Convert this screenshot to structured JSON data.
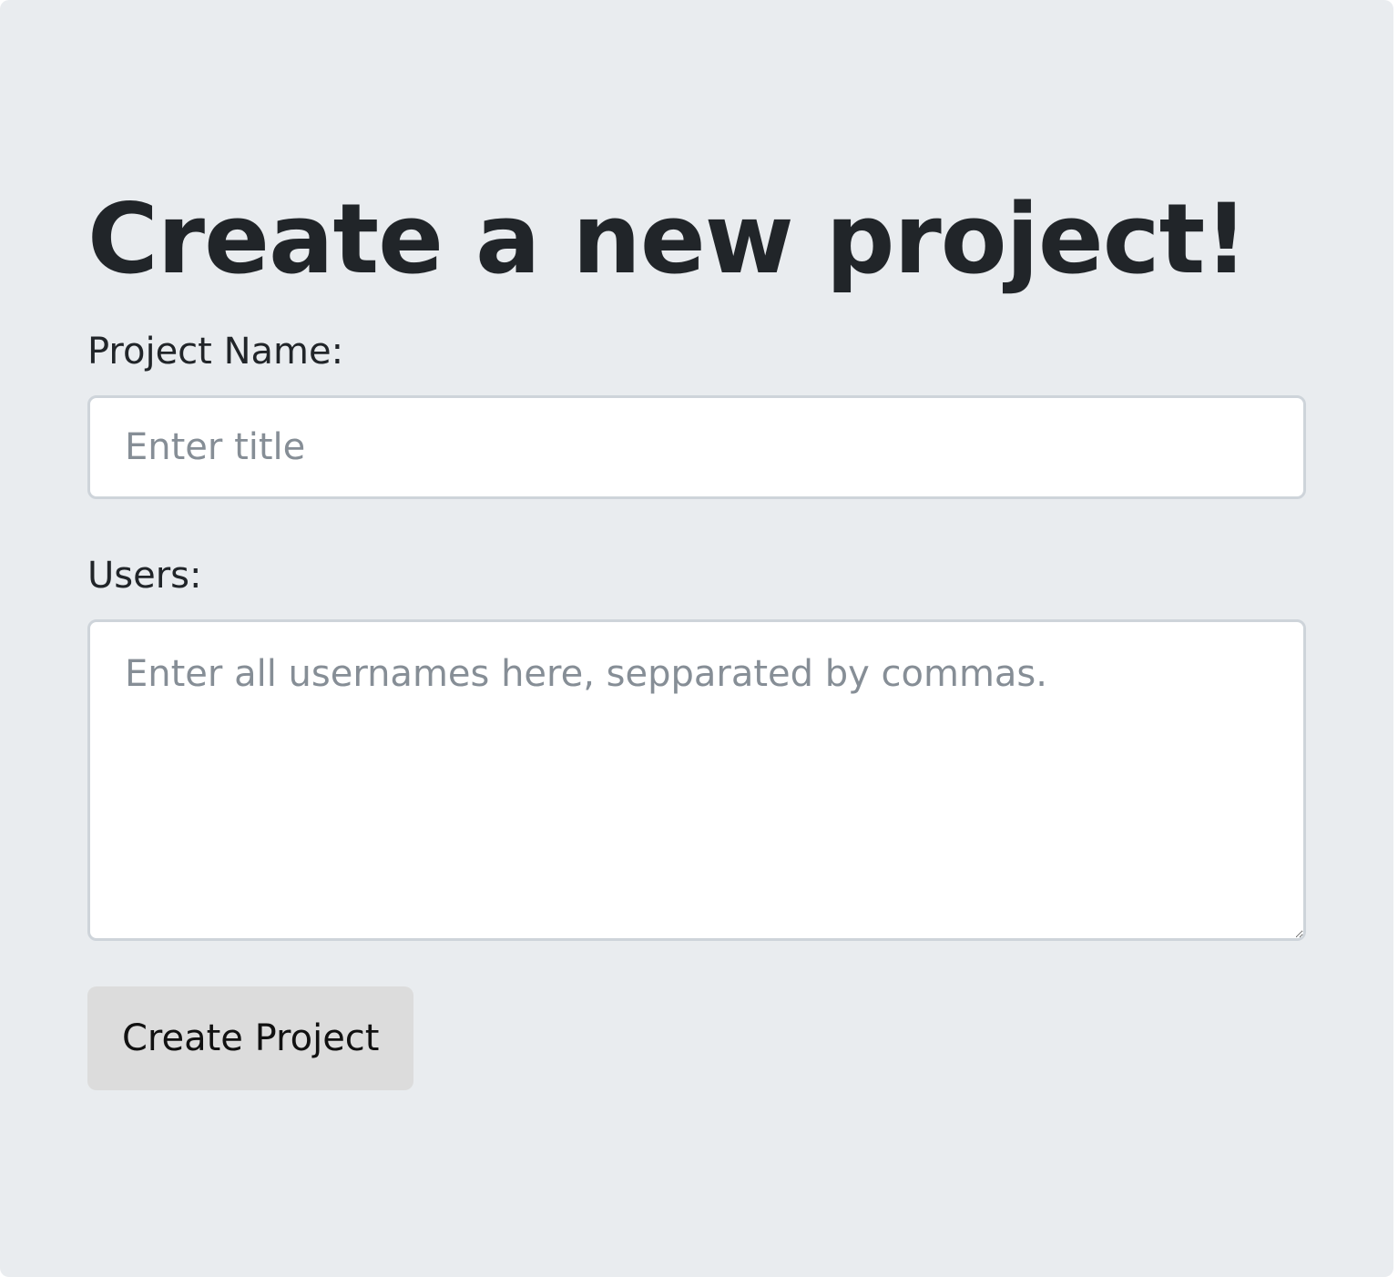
{
  "form": {
    "title": "Create a new project!",
    "project_name_label": "Project Name:",
    "project_name_placeholder": "Enter title",
    "project_name_value": "",
    "users_label": "Users:",
    "users_placeholder": "Enter all usernames here, sepparated by commas.",
    "users_value": "",
    "submit_label": "Create Project"
  },
  "colors": {
    "background": "#e9ecef",
    "text": "#212529",
    "placeholder": "#868e96",
    "input_border": "#ced4da",
    "button_background": "#dcdcdc"
  }
}
